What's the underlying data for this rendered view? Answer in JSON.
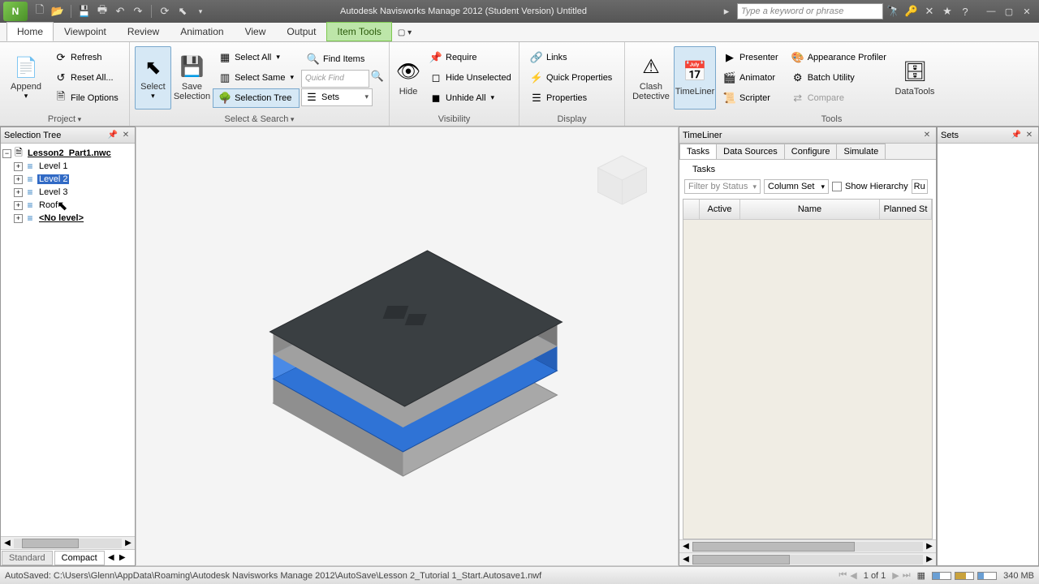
{
  "title": "Autodesk Navisworks Manage 2012 (Student Version)    Untitled",
  "search_placeholder": "Type a keyword or phrase",
  "tabs": {
    "home": "Home",
    "viewpoint": "Viewpoint",
    "review": "Review",
    "animation": "Animation",
    "view": "View",
    "output": "Output",
    "item_tools": "Item Tools"
  },
  "ribbon": {
    "project": {
      "append": "Append",
      "refresh": "Refresh",
      "reset": "Reset All...",
      "fileopts": "File Options",
      "title": "Project"
    },
    "select": {
      "select": "Select",
      "save": "Save\nSelection",
      "select_all": "Select All",
      "select_same": "Select Same",
      "selection_tree": "Selection Tree",
      "find_items": "Find Items",
      "quick_find": "Quick Find",
      "sets": "Sets",
      "title": "Select & Search"
    },
    "visibility": {
      "hide": "Hide",
      "require": "Require",
      "hide_unsel": "Hide Unselected",
      "unhide": "Unhide All",
      "title": "Visibility"
    },
    "display": {
      "links": "Links",
      "quickprops": "Quick Properties",
      "props": "Properties",
      "title": "Display"
    },
    "tools": {
      "clash": "Clash\nDetective",
      "timeliner": "TimeLiner",
      "datatools": "DataTools",
      "presenter": "Presenter",
      "animator": "Animator",
      "scripter": "Scripter",
      "appprof": "Appearance Profiler",
      "batch": "Batch Utility",
      "compare": "Compare",
      "title": "Tools"
    }
  },
  "seltree": {
    "title": "Selection Tree",
    "root": "Lesson2_Part1.nwc",
    "items": [
      "Level 1",
      "Level 2",
      "Level 3",
      "Roof",
      "<No level>"
    ],
    "selected_index": 1,
    "footer": {
      "standard": "Standard",
      "compact": "Compact"
    }
  },
  "timeliner": {
    "title": "TimeLiner",
    "tabs": [
      "Tasks",
      "Data Sources",
      "Configure",
      "Simulate"
    ],
    "tasks_label": "Tasks",
    "filter": "Filter by Status",
    "colset": "Column Set",
    "showh": "Show Hierarchy",
    "ru": "Ru",
    "cols": [
      "Active",
      "Name",
      "Planned St"
    ]
  },
  "sets": {
    "title": "Sets"
  },
  "status": {
    "text": "AutoSaved:  C:\\Users\\Glenn\\AppData\\Roaming\\Autodesk Navisworks Manage 2012\\AutoSave\\Lesson 2_Tutorial 1_Start.Autosave1.nwf",
    "page": "1 of 1",
    "mem": "340 MB"
  }
}
